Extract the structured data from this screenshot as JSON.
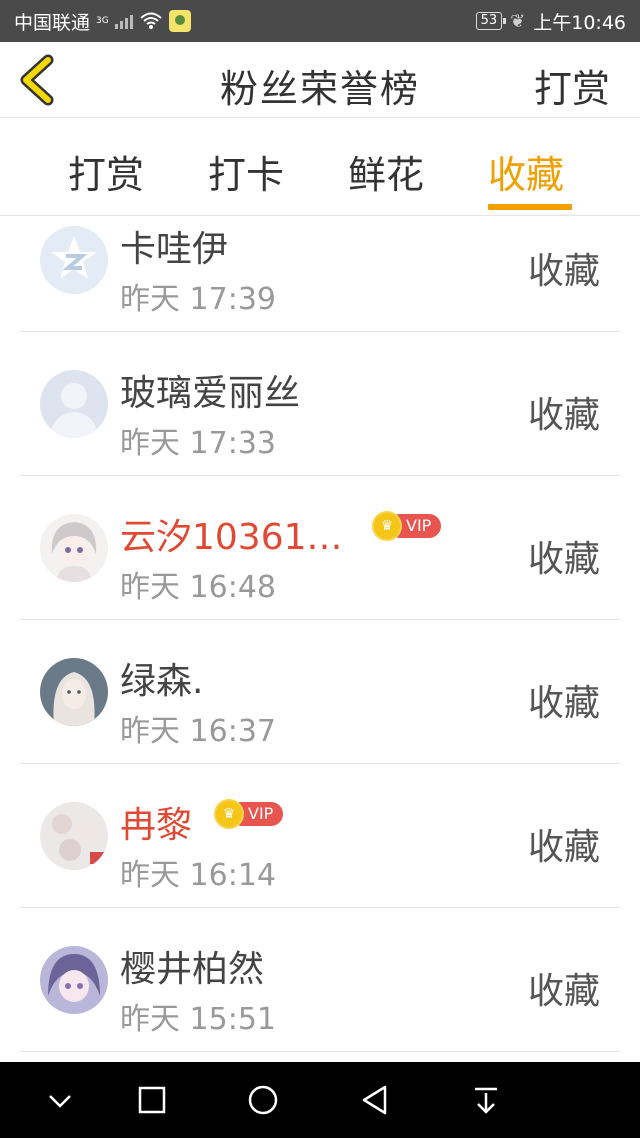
{
  "status_bar": {
    "carrier": "中国联通",
    "network": "3G",
    "battery": "53",
    "time": "上午10:46"
  },
  "nav": {
    "title": "粉丝荣誉榜",
    "right_action": "打赏",
    "back_icon": "back-chevron-icon"
  },
  "tabs": [
    {
      "label": "打赏",
      "active": false
    },
    {
      "label": "打卡",
      "active": false
    },
    {
      "label": "鲜花",
      "active": false
    },
    {
      "label": "收藏",
      "active": true
    }
  ],
  "vip_label": "VIP",
  "rows": [
    {
      "name": "卡哇伊",
      "time": "昨天 17:39",
      "action": "收藏",
      "vip": false,
      "avatar": "qq-logo-avatar"
    },
    {
      "name": "玻璃爱丽丝",
      "time": "昨天 17:33",
      "action": "收藏",
      "vip": false,
      "avatar": "default-person-avatar"
    },
    {
      "name": "云汐10361…",
      "time": "昨天 16:48",
      "action": "收藏",
      "vip": true,
      "avatar": "anime-girl-avatar"
    },
    {
      "name": "绿森.",
      "time": "昨天 16:37",
      "action": "收藏",
      "vip": false,
      "avatar": "photo-avatar"
    },
    {
      "name": "冉黎",
      "time": "昨天 16:14",
      "action": "收藏",
      "vip": true,
      "avatar": "photo-avatar"
    },
    {
      "name": "樱井柏然",
      "time": "昨天 15:51",
      "action": "收藏",
      "vip": false,
      "avatar": "anime-girl-avatar"
    }
  ],
  "colors": {
    "accent": "#f0a000",
    "vip_name": "#e04a34",
    "back_chevron": "#f5d800",
    "status_bar_bg": "#4a4a4a",
    "system_nav_bg": "#000000"
  }
}
